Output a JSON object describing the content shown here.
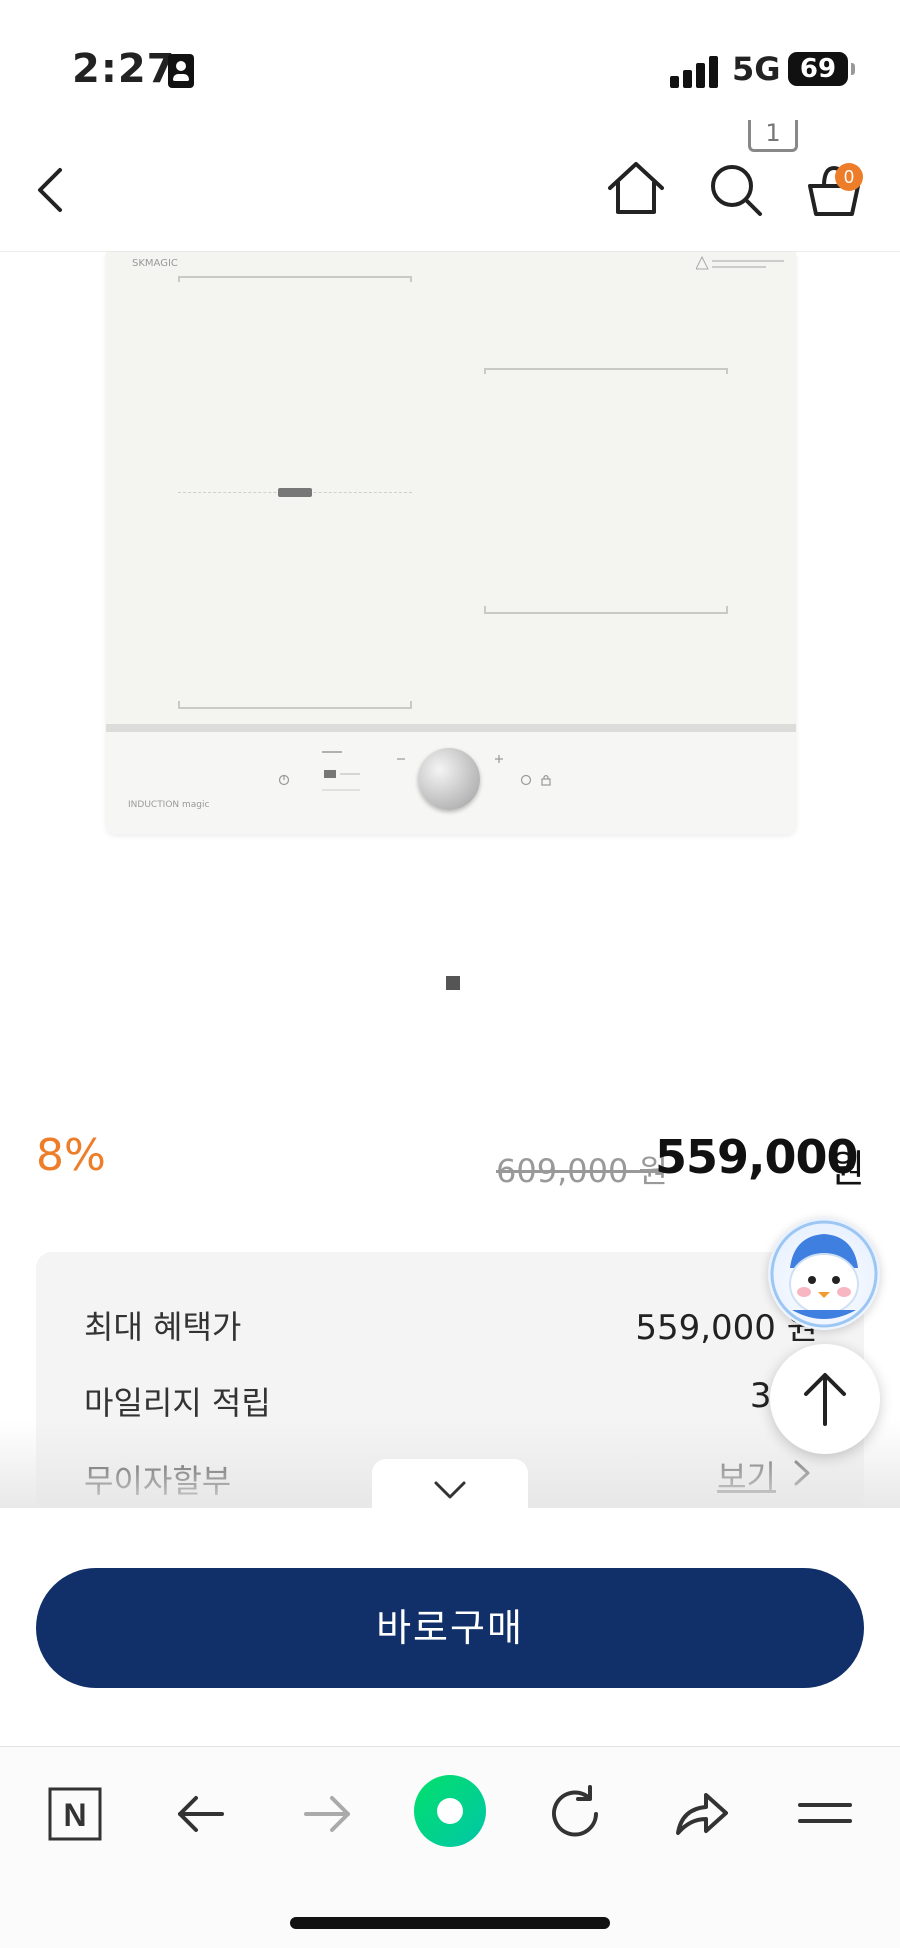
{
  "status_bar": {
    "time": "2:27",
    "network": "5G",
    "battery": "69",
    "icons": [
      "id-card-icon",
      "signal-icon",
      "battery-icon"
    ]
  },
  "header": {
    "tab_count": "1",
    "cart_count": "0",
    "icons": [
      "back-chevron-icon",
      "home-icon",
      "search-icon",
      "cart-icon"
    ],
    "accent_color": "#ee7d2a"
  },
  "product_image": {
    "brand_mark": "SKMAGIC",
    "model_mark": "INDUCTION magic",
    "carousel": {
      "total": 1,
      "current": 1
    }
  },
  "price": {
    "discount_rate": "8%",
    "original_price": "609,000 원",
    "sale_price": "559,000",
    "unit": "원"
  },
  "benefits": {
    "rows": [
      {
        "label": "최대 혜택가",
        "value": "559,000 원"
      },
      {
        "label": "마일리지 적립",
        "value": "3.0"
      },
      {
        "label": "무이자할부",
        "link": "보기"
      }
    ]
  },
  "purchase": {
    "buy_now_label": "바로구매",
    "button_color": "#113069"
  },
  "browser_toolbar": {
    "icons": [
      "naver-n-icon",
      "back-arrow-icon",
      "forward-arrow-icon",
      "green-dot-icon",
      "refresh-icon",
      "share-icon",
      "menu-icon"
    ],
    "naver_letter": "N",
    "green_color": "#03c75a"
  }
}
